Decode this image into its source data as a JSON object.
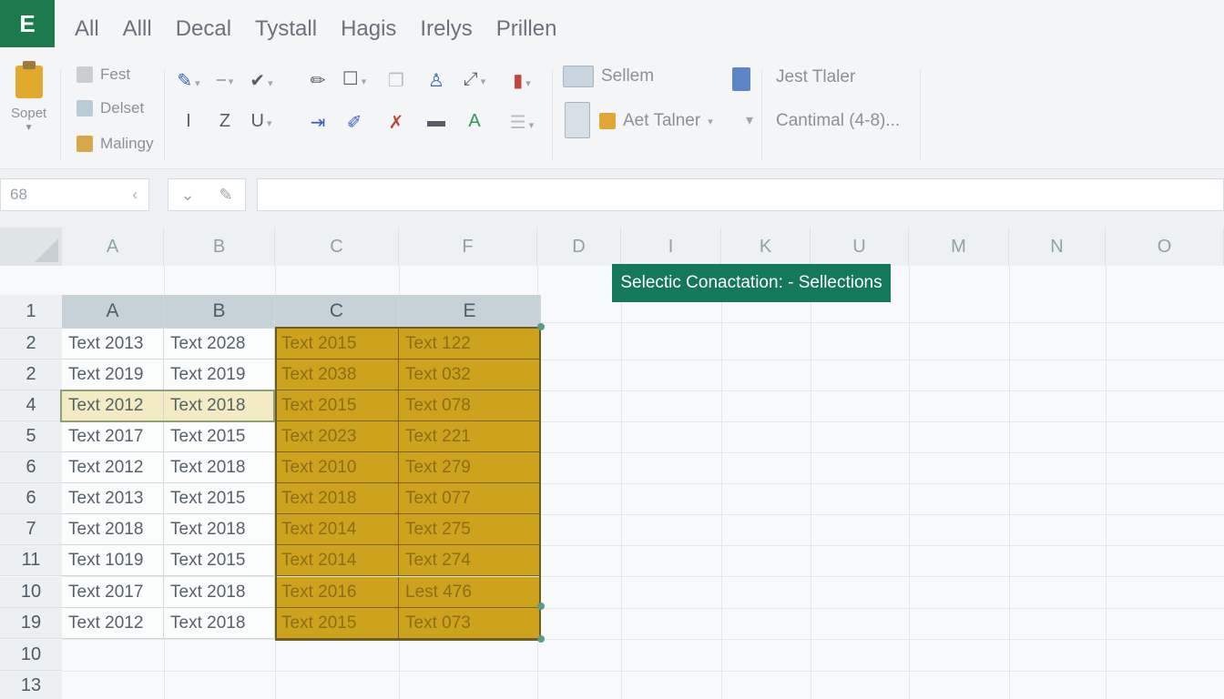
{
  "app": {
    "logo_glyph": "E",
    "accent": "#1d7a4c"
  },
  "menu": [
    "All",
    "Alll",
    "Decal",
    "Tystall",
    "Hagis",
    "Irelys",
    "Prillen"
  ],
  "ribbon": {
    "paste_label": "Sopet",
    "clip_items": [
      "Fest",
      "Delset",
      "Malingy"
    ],
    "sellem_label": "Sellem",
    "autotable_label": "Aet Talner",
    "style_label": "Jest Tlaler",
    "format_label": "Cantimal (4-8)..."
  },
  "formula_bar": {
    "namebox": "68"
  },
  "sheet": {
    "top_columns": [
      "A",
      "B",
      "C",
      "F",
      "D",
      "I",
      "K",
      "U",
      "M",
      "N",
      "O"
    ],
    "row_numbers": [
      "1",
      "2",
      "2",
      "4",
      "5",
      "6",
      "6",
      "7",
      "11",
      "10",
      "19",
      "10",
      "13"
    ],
    "table_header": [
      "A",
      "B",
      "C",
      "E"
    ],
    "table_rows": [
      [
        "Text 2013",
        "Text 2028",
        "Text 2015",
        "Text 122"
      ],
      [
        "Text 2019",
        "Text 2019",
        "Text 2038",
        "Text 032"
      ],
      [
        "Text 2012",
        "Text 2018",
        "Text 2015",
        "Text 078"
      ],
      [
        "Text 2017",
        "Text 2015",
        "Text 2023",
        "Text 221"
      ],
      [
        "Text 2012",
        "Text 2018",
        "Text 2010",
        "Text 279"
      ],
      [
        "Text 2013",
        "Text 2015",
        "Text 2018",
        "Text 077"
      ],
      [
        "Text 2018",
        "Text 2018",
        "Text 2014",
        "Text 275"
      ],
      [
        "Text 1019",
        "Text 2015",
        "Text 2014",
        "Text 274"
      ],
      [
        "Text 2017",
        "Text 2018",
        "Text 2016",
        "Lest 476"
      ],
      [
        "Text 2012",
        "Text 2018",
        "Text 2015",
        "Text 073"
      ]
    ],
    "selection_color": "#cda21c"
  },
  "tooltip": {
    "text": "Selectic Conactation: - Sellections",
    "color": "#14785b"
  }
}
